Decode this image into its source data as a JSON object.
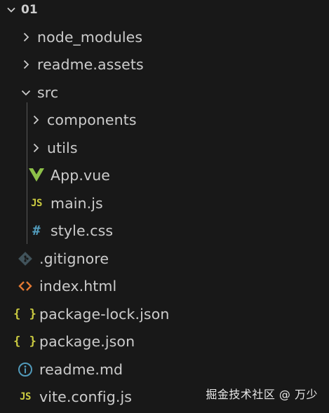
{
  "explorer": {
    "root": {
      "label": "01"
    },
    "items": [
      {
        "label": "node_modules"
      },
      {
        "label": "readme.assets"
      },
      {
        "label": "src"
      },
      {
        "label": "components"
      },
      {
        "label": "utils"
      },
      {
        "label": "App.vue"
      },
      {
        "label": "main.js"
      },
      {
        "label": "style.css"
      },
      {
        "label": ".gitignore"
      },
      {
        "label": "index.html"
      },
      {
        "label": "package-lock.json"
      },
      {
        "label": "package.json"
      },
      {
        "label": "readme.md"
      },
      {
        "label": "vite.config.js"
      }
    ]
  },
  "icons": {
    "js": "JS",
    "css": "#",
    "json": "{ }"
  },
  "colors": {
    "background": "#181818",
    "text": "#cccccc",
    "vue": "#8dc149",
    "js": "#cbcb41",
    "css": "#519aba",
    "html": "#e37933",
    "git": "#41535b",
    "info": "#519aba"
  },
  "watermark": "掘金技术社区 @ 万少"
}
